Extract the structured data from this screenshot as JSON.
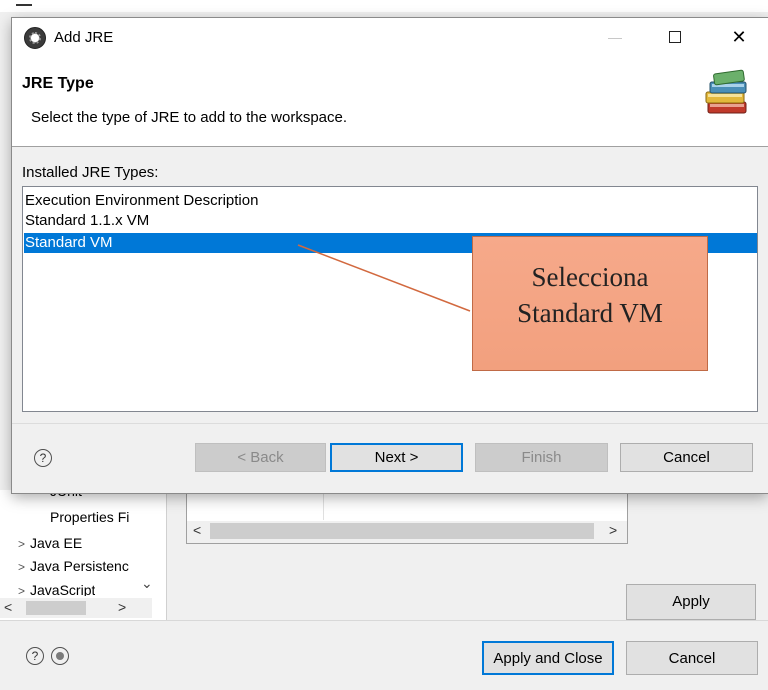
{
  "background_window": {
    "tree_items": [
      {
        "label": "JUnit",
        "arrow": ""
      },
      {
        "label": "Properties Fi",
        "arrow": ""
      },
      {
        "label": "Java EE",
        "arrow": ">"
      },
      {
        "label": "Java Persistenc",
        "arrow": ">"
      },
      {
        "label": "JavaScript",
        "arrow": ">"
      }
    ],
    "apply_label": "Apply",
    "apply_close_label": "Apply and Close",
    "cancel_label": "Cancel",
    "help_glyph": "?",
    "scroll_left": "<",
    "scroll_right": ">",
    "scroll_down": "⌄"
  },
  "dialog": {
    "title": "Add JRE",
    "close_glyph": "✕",
    "header": {
      "title": "JRE Type",
      "description": "Select the type of JRE to add to the workspace."
    },
    "installed_label": "Installed JRE Types:",
    "jre_types": [
      {
        "label": "Execution Environment Description",
        "selected": false
      },
      {
        "label": "Standard 1.1.x VM",
        "selected": false
      },
      {
        "label": "Standard VM",
        "selected": true
      }
    ],
    "buttons": {
      "help": "?",
      "back": "< Back",
      "next": "Next >",
      "finish": "Finish",
      "cancel": "Cancel"
    }
  },
  "annotation": {
    "line1": "Selecciona",
    "line2": "Standard VM"
  },
  "colors": {
    "selection": "#0078d7",
    "callout_fill": "#f4a582",
    "callout_line": "#d2693f"
  }
}
